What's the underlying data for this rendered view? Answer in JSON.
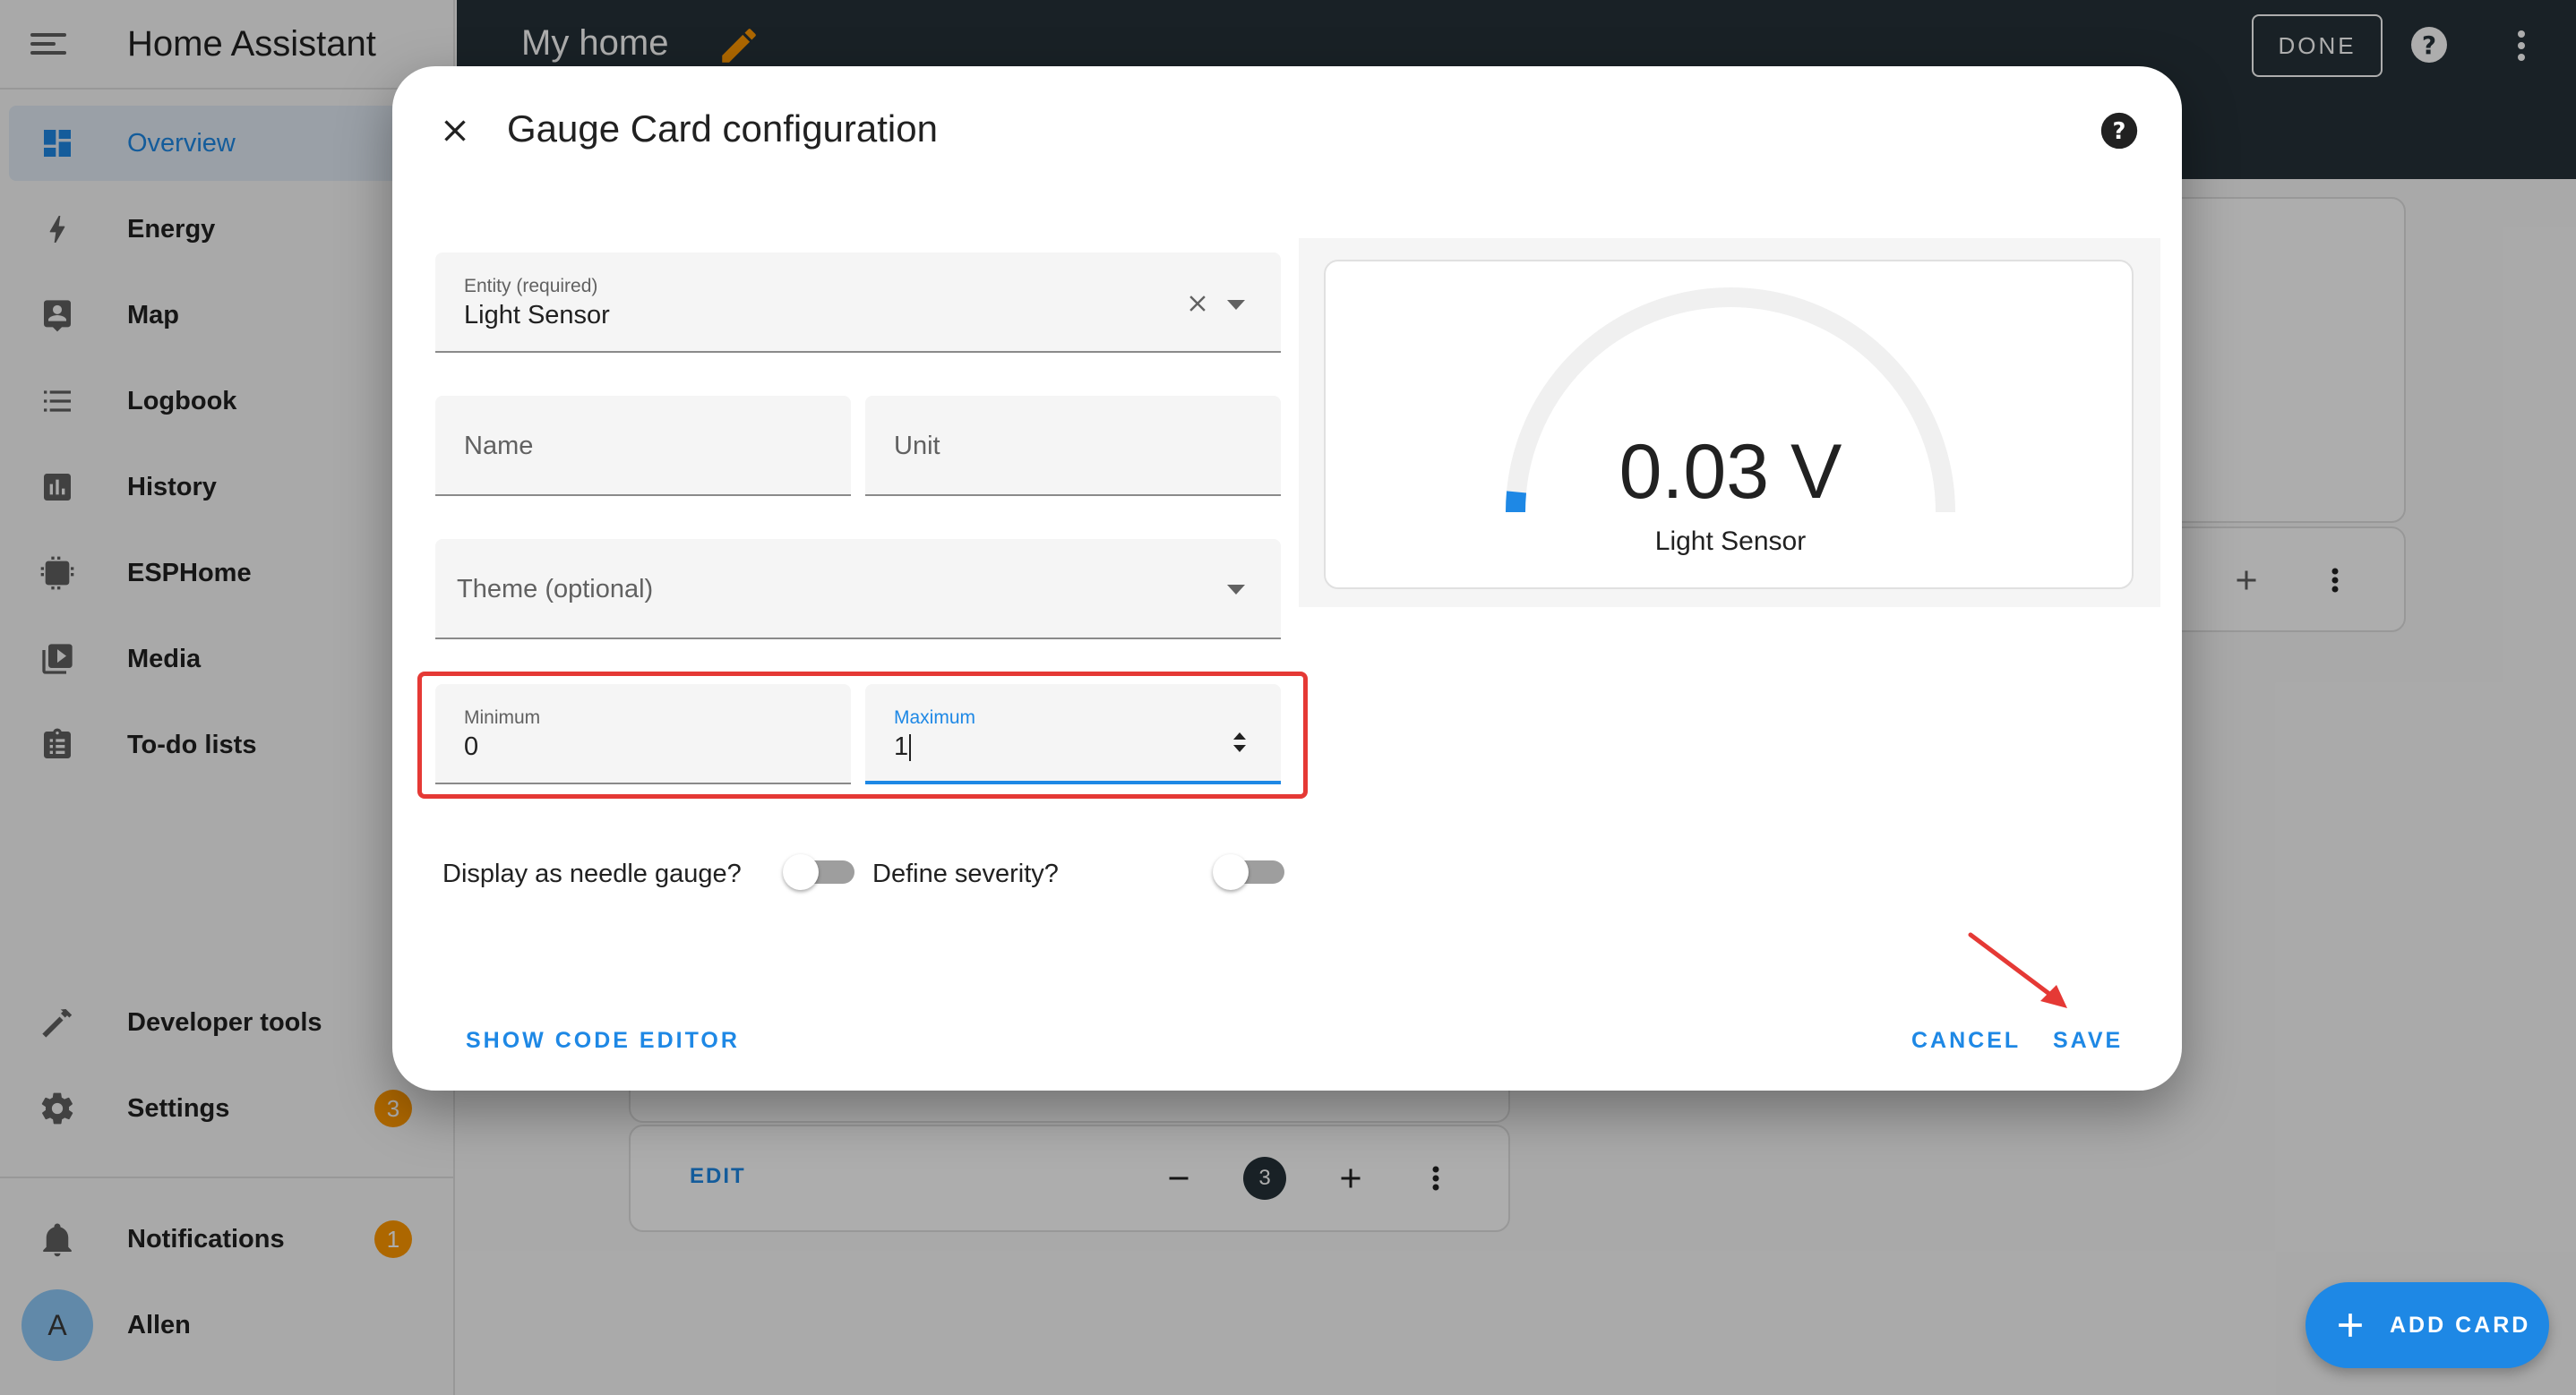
{
  "app": {
    "title": "Home Assistant"
  },
  "sidebar": {
    "items": [
      {
        "label": "Overview",
        "icon": "dashboard-icon",
        "active": true
      },
      {
        "label": "Energy",
        "icon": "lightning-icon"
      },
      {
        "label": "Map",
        "icon": "map-icon"
      },
      {
        "label": "Logbook",
        "icon": "logbook-icon"
      },
      {
        "label": "History",
        "icon": "history-icon"
      },
      {
        "label": "ESPHome",
        "icon": "chip-icon"
      },
      {
        "label": "Media",
        "icon": "media-icon"
      },
      {
        "label": "To-do lists",
        "icon": "clipboard-icon"
      }
    ],
    "bottom": [
      {
        "label": "Developer tools",
        "icon": "hammer-icon"
      },
      {
        "label": "Settings",
        "icon": "gear-icon",
        "badge": "3"
      },
      {
        "label": "Notifications",
        "icon": "bell-icon",
        "badge": "1"
      },
      {
        "label": "Allen",
        "avatar": "A"
      }
    ]
  },
  "topbar": {
    "title": "My home",
    "done_label": "DONE"
  },
  "background": {
    "edit_label": "EDIT",
    "count": "3"
  },
  "fab": {
    "label": "ADD CARD"
  },
  "dialog": {
    "title": "Gauge Card configuration",
    "entity": {
      "label": "Entity (required)",
      "value": "Light Sensor"
    },
    "name": {
      "placeholder": "Name"
    },
    "unit": {
      "placeholder": "Unit"
    },
    "theme": {
      "placeholder": "Theme (optional)"
    },
    "minimum": {
      "label": "Minimum",
      "value": "0"
    },
    "maximum": {
      "label": "Maximum",
      "value": "1"
    },
    "needle_toggle": {
      "label": "Display as needle gauge?",
      "on": false
    },
    "severity_toggle": {
      "label": "Define severity?",
      "on": false
    },
    "show_code_label": "SHOW CODE EDITOR",
    "cancel_label": "CANCEL",
    "save_label": "SAVE"
  },
  "preview": {
    "value": "0.03 V",
    "name": "Light Sensor",
    "fraction": 0.03,
    "colors": {
      "fill": "#1e88e5",
      "track": "#f0f0f0"
    }
  },
  "colors": {
    "accent": "#1e88e5",
    "header": "#263238",
    "badge": "#ff9800",
    "highlight": "#e53935"
  }
}
